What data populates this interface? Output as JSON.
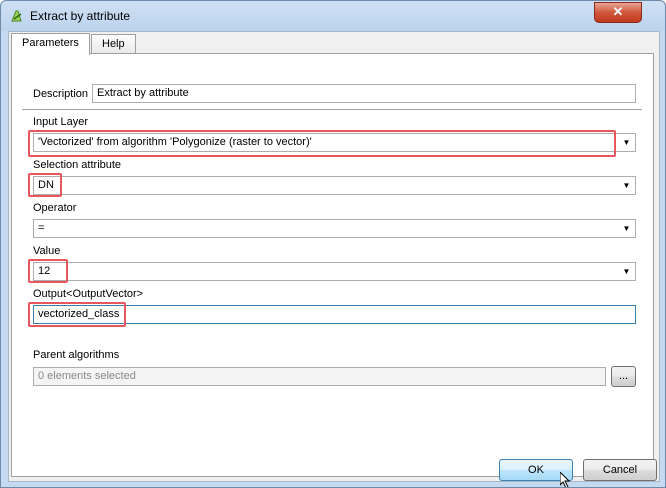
{
  "window": {
    "title": "Extract by attribute",
    "close_label": "✕"
  },
  "tabs": [
    {
      "label": "Parameters",
      "active": true
    },
    {
      "label": "Help",
      "active": false
    }
  ],
  "form": {
    "description": {
      "label": "Description",
      "value": "Extract by attribute"
    },
    "input_layer": {
      "label": "Input Layer",
      "value": "'Vectorized' from algorithm 'Polygonize (raster to vector)'"
    },
    "selection_attribute": {
      "label": "Selection attribute",
      "value": "DN"
    },
    "operator": {
      "label": "Operator",
      "value": "="
    },
    "value": {
      "label": "Value",
      "value": "12"
    },
    "output": {
      "label": "Output<OutputVector>",
      "value": "vectorized_class"
    },
    "parent_algorithms": {
      "label": "Parent algorithms",
      "value": "0 elements selected",
      "button_label": "..."
    }
  },
  "buttons": {
    "ok": "OK",
    "cancel": "Cancel"
  },
  "colors": {
    "highlight": "#e8575e",
    "focus": "#3c7fb1"
  }
}
